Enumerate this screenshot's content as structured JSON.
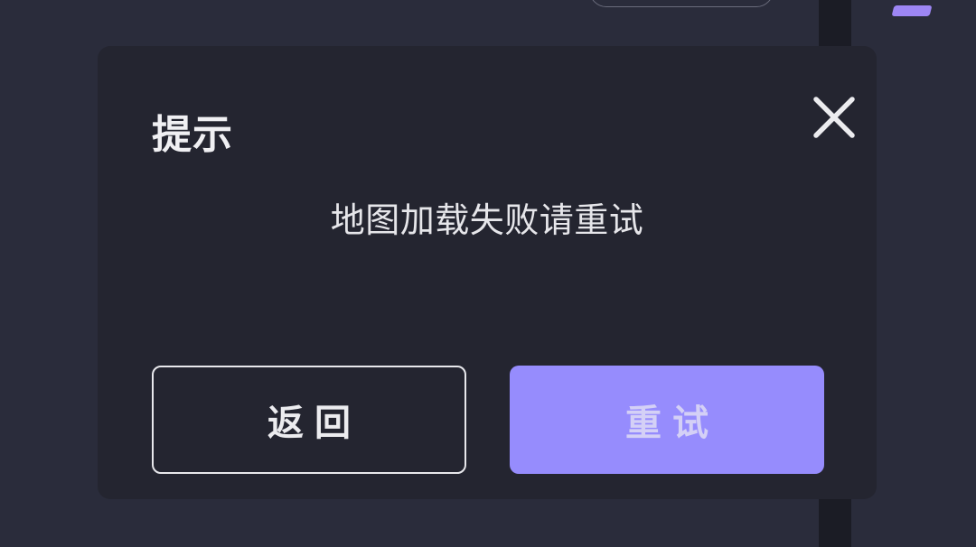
{
  "dialog": {
    "title": "提示",
    "message": "地图加载失败请重试",
    "close_icon": "close-icon",
    "buttons": {
      "back_label": "返回",
      "retry_label": "重试"
    }
  },
  "colors": {
    "background": "#2a2c3b",
    "dialog_background": "#242530",
    "accent": "#968cfd",
    "side_strip": "#1b1c25",
    "accent_tab": "#9d86f4"
  }
}
